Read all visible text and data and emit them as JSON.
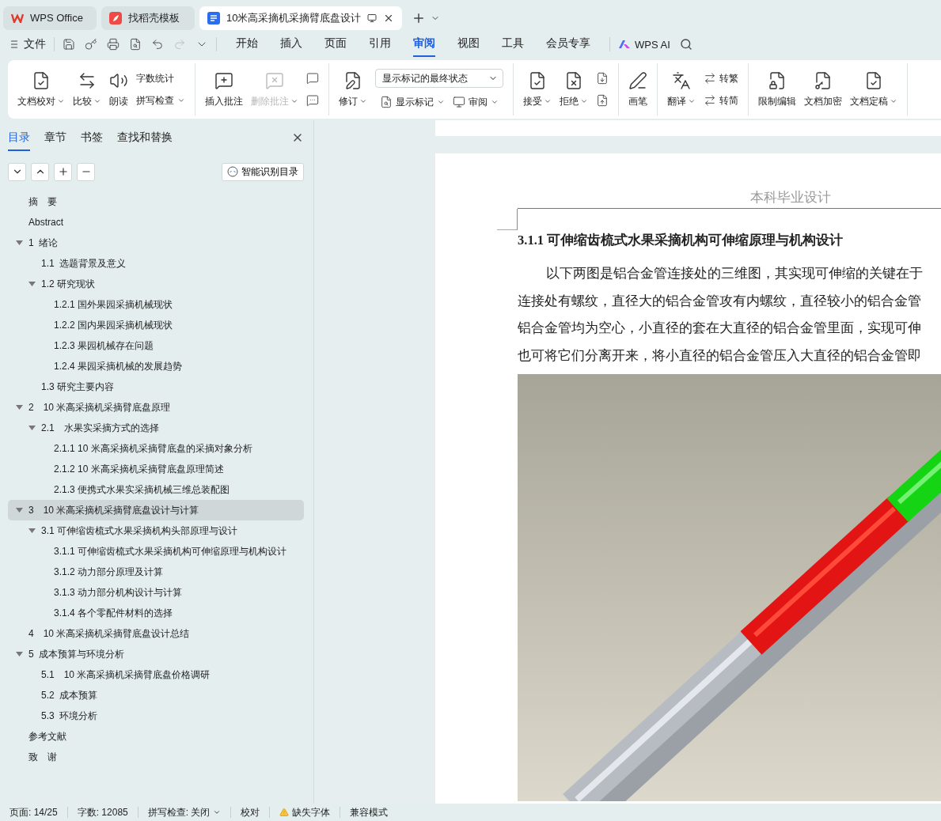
{
  "window_tabs": [
    {
      "kind": "home",
      "label": "WPS Office",
      "selected": false
    },
    {
      "kind": "template",
      "label": "找稻壳模板",
      "selected": false
    },
    {
      "kind": "document",
      "label": "10米高采摘机采摘臂底盘设计",
      "selected": true
    }
  ],
  "menu_bar": {
    "file": "文件",
    "tabs": [
      {
        "label": "开始",
        "selected": false
      },
      {
        "label": "插入",
        "selected": false
      },
      {
        "label": "页面",
        "selected": false
      },
      {
        "label": "引用",
        "selected": false
      },
      {
        "label": "审阅",
        "selected": true
      },
      {
        "label": "视图",
        "selected": false
      },
      {
        "label": "工具",
        "selected": false
      },
      {
        "label": "会员专享",
        "selected": false
      }
    ],
    "ai": "WPS AI"
  },
  "ribbon": [
    {
      "items": [
        {
          "kind": "large",
          "label": "文档校对",
          "menu": true,
          "disabled": false
        },
        {
          "kind": "large",
          "label": "比较",
          "menu": true,
          "disabled": false
        },
        {
          "kind": "large",
          "label": "朗读",
          "menu": false,
          "disabled": false
        },
        {
          "kind": "stack",
          "rows": [
            {
              "label": "字数统计",
              "menu": false
            },
            {
              "label": "拼写检查",
              "menu": true
            }
          ]
        }
      ]
    },
    {
      "items": [
        {
          "kind": "large",
          "label": "插入批注",
          "menu": false,
          "disabled": false
        },
        {
          "kind": "large",
          "label": "删除批注",
          "menu": true,
          "disabled": true
        },
        {
          "kind": "stack",
          "rows": [
            {
              "menu": false
            },
            {
              "menu": false
            }
          ]
        }
      ]
    },
    {
      "items": [
        {
          "kind": "large",
          "label": "修订",
          "menu": true,
          "disabled": false
        },
        {
          "kind": "select",
          "value": "显示标记的最终状态",
          "rows": [
            {
              "label": "显示标记",
              "menu": true
            },
            {
              "label": "审阅",
              "menu": true
            }
          ]
        }
      ]
    },
    {
      "items": [
        {
          "kind": "large",
          "label": "接受",
          "menu": true,
          "disabled": false
        },
        {
          "kind": "large",
          "label": "拒绝",
          "menu": true,
          "disabled": false
        },
        {
          "kind": "stack",
          "rows": [
            {
              "menu": false
            },
            {
              "menu": false
            }
          ]
        }
      ]
    },
    {
      "items": [
        {
          "kind": "large",
          "label": "画笔",
          "menu": false,
          "disabled": false
        }
      ]
    },
    {
      "items": [
        {
          "kind": "large",
          "label": "翻译",
          "menu": true,
          "disabled": false
        },
        {
          "kind": "stack",
          "rows": [
            {
              "label": "转繁",
              "menu": false
            },
            {
              "label": "转简",
              "menu": false
            }
          ]
        }
      ]
    },
    {
      "items": [
        {
          "kind": "large",
          "label": "限制编辑",
          "menu": false,
          "disabled": false
        },
        {
          "kind": "large",
          "label": "文档加密",
          "menu": false,
          "disabled": false
        },
        {
          "kind": "large",
          "label": "文档定稿",
          "menu": true,
          "disabled": false
        }
      ]
    }
  ],
  "nav_panel": {
    "tabs": [
      {
        "label": "目录",
        "selected": true
      },
      {
        "label": "章节",
        "selected": false
      },
      {
        "label": "书签",
        "selected": false
      },
      {
        "label": "查找和替换",
        "selected": false
      }
    ],
    "smart_button": "智能识别目录",
    "toc": [
      {
        "label": "摘　要",
        "selected": false
      },
      {
        "label": "Abstract",
        "selected": false
      },
      {
        "label": "1  绪论",
        "selected": false,
        "expanded": true,
        "children": [
          {
            "label": "1.1  选题背景及意义",
            "selected": false
          },
          {
            "label": "1.2 研究现状",
            "selected": false,
            "expanded": true,
            "children": [
              {
                "label": "1.2.1 国外果园采摘机械现状",
                "selected": false
              },
              {
                "label": "1.2.2 国内果园采摘机械现状",
                "selected": false
              },
              {
                "label": "1.2.3 果园机械存在问题",
                "selected": false
              },
              {
                "label": "1.2.4 果园采摘机械的发展趋势",
                "selected": false
              }
            ]
          },
          {
            "label": "1.3 研究主要内容",
            "selected": false
          }
        ]
      },
      {
        "label": "2　10 米高采摘机采摘臂底盘原理",
        "selected": false,
        "expanded": true,
        "children": [
          {
            "label": "2.1　水果实采摘方式的选择",
            "selected": false,
            "expanded": true,
            "children": [
              {
                "label": "2.1.1 10 米高采摘机采摘臂底盘的采摘对象分析",
                "selected": false
              },
              {
                "label": "2.1.2 10 米高采摘机采摘臂底盘原理简述",
                "selected": false
              },
              {
                "label": "2.1.3 便携式水果实采摘机械三维总装配图",
                "selected": false
              }
            ]
          }
        ]
      },
      {
        "label": "3　10 米高采摘机采摘臂底盘设计与计算",
        "selected": true,
        "expanded": true,
        "children": [
          {
            "label": "3.1 可伸缩齿梳式水果采摘机构头部原理与设计",
            "selected": false,
            "expanded": true,
            "children": [
              {
                "label": "3.1.1 可伸缩齿梳式水果采摘机构可伸缩原理与机构设计",
                "selected": false
              },
              {
                "label": "3.1.2 动力部分原理及计算",
                "selected": false
              },
              {
                "label": "3.1.3 动力部分机构设计与计算",
                "selected": false
              },
              {
                "label": "3.1.4 各个零配件材料的选择",
                "selected": false
              }
            ]
          }
        ]
      },
      {
        "label": "4　10 米高采摘机采摘臂底盘设计总结",
        "selected": false
      },
      {
        "label": "5  成本预算与环境分析",
        "selected": false,
        "expanded": true,
        "children": [
          {
            "label": "5.1　10 米高采摘机采摘臂底盘价格调研",
            "selected": false
          },
          {
            "label": "5.2  成本预算",
            "selected": false
          },
          {
            "label": "5.3  环境分析",
            "selected": false
          }
        ]
      },
      {
        "label": "参考文献",
        "selected": false
      },
      {
        "label": "致　谢",
        "selected": false
      }
    ]
  },
  "document": {
    "header": "本科毕业设计",
    "heading": "3.1.1 可伸缩齿梳式水果采摘机构可伸缩原理与机构设计",
    "lines": [
      {
        "text": "以下两图是铝合金管连接处的三维图，其实现可伸缩的关键在于",
        "indent": true
      },
      {
        "text": "连接处有螺纹，直径大的铝合金管攻有内螺纹，直径较小的铝合金管",
        "indent": false
      },
      {
        "text": "铝合金管均为空心，小直径的套在大直径的铝合金管里面，实现可伸",
        "indent": false
      },
      {
        "text": "也可将它们分离开来，将小直径的铝合金管压入大直径的铝合金管即",
        "indent": false
      }
    ]
  },
  "status_bar": [
    {
      "kind": "text",
      "label": "页面: 14/25"
    },
    {
      "kind": "text",
      "label": "字数: 12085"
    },
    {
      "kind": "menu",
      "label": "拼写检查: 关闭"
    },
    {
      "kind": "text",
      "label": "校对"
    },
    {
      "kind": "warning",
      "label": "缺失字体"
    },
    {
      "kind": "text",
      "label": "兼容模式"
    }
  ]
}
